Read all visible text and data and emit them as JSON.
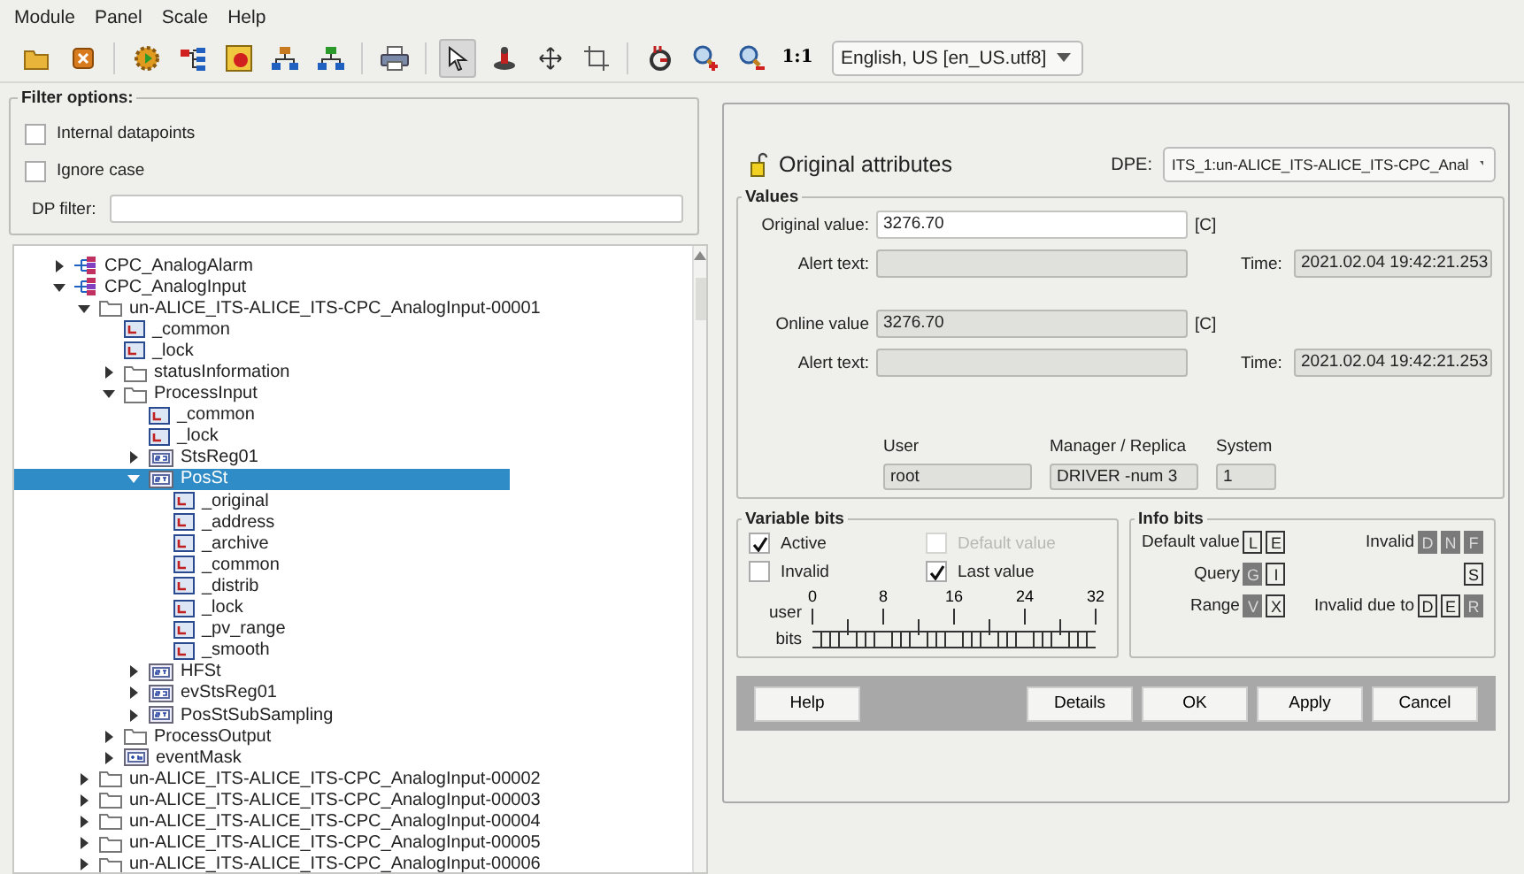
{
  "menu": [
    "Module",
    "Panel",
    "Scale",
    "Help"
  ],
  "toolbar": {
    "tools": [
      {
        "kind": "open",
        "selected": false
      },
      {
        "kind": "close",
        "selected": false
      },
      {
        "kind": "sep"
      },
      {
        "kind": "gear",
        "selected": false
      },
      {
        "kind": "nodes",
        "selected": false
      },
      {
        "kind": "panel",
        "selected": false
      },
      {
        "kind": "tree",
        "selected": false
      },
      {
        "kind": "tree2",
        "selected": false
      },
      {
        "kind": "sep"
      },
      {
        "kind": "print",
        "selected": false
      },
      {
        "kind": "sep"
      },
      {
        "kind": "pointer",
        "selected": true
      },
      {
        "kind": "stamp",
        "selected": false
      },
      {
        "kind": "move",
        "selected": false
      },
      {
        "kind": "frame",
        "selected": false
      },
      {
        "kind": "sep"
      },
      {
        "kind": "g",
        "selected": false
      },
      {
        "kind": "zoomin",
        "selected": false
      },
      {
        "kind": "zoomout",
        "selected": false
      },
      {
        "kind": "text",
        "label": "1:1",
        "selected": false
      }
    ],
    "language": "English, US [en_US.utf8]"
  },
  "filter": {
    "title": "Filter options:",
    "checkboxes": [
      {
        "label": "Internal datapoints",
        "checked": false
      },
      {
        "label": "Ignore case",
        "checked": false
      }
    ],
    "dp_filter": {
      "label": "DP filter:"
    }
  },
  "tree": {
    "items": [
      {
        "label": "CPC_AnalogAlarm",
        "kind": "dpt",
        "expanded": false,
        "selected": false
      },
      {
        "label": "CPC_AnalogInput",
        "kind": "dpt",
        "expanded": true,
        "selected": false,
        "children": [
          {
            "label": "un-ALICE_ITS-ALICE_ITS-CPC_AnalogInput-00001",
            "kind": "folder",
            "expanded": true,
            "selected": false,
            "children": [
              {
                "label": "_common",
                "kind": "config",
                "selected": false
              },
              {
                "label": "_lock",
                "kind": "config",
                "selected": false
              },
              {
                "label": "statusInformation",
                "kind": "folder",
                "expanded": false,
                "selected": false
              },
              {
                "label": "ProcessInput",
                "kind": "folder",
                "expanded": true,
                "selected": false,
                "children": [
                  {
                    "label": "_common",
                    "kind": "config",
                    "selected": false
                  },
                  {
                    "label": "_lock",
                    "kind": "config",
                    "selected": false
                  },
                  {
                    "label": "StsReg01",
                    "kind": "int",
                    "expanded": false,
                    "selected": false
                  },
                  {
                    "label": "PosSt",
                    "kind": "float",
                    "expanded": true,
                    "selected": true,
                    "children": [
                      {
                        "label": "_original",
                        "kind": "config",
                        "selected": false
                      },
                      {
                        "label": "_address",
                        "kind": "config",
                        "selected": false
                      },
                      {
                        "label": "_archive",
                        "kind": "config",
                        "selected": false
                      },
                      {
                        "label": "_common",
                        "kind": "config",
                        "selected": false
                      },
                      {
                        "label": "_distrib",
                        "kind": "config",
                        "selected": false
                      },
                      {
                        "label": "_lock",
                        "kind": "config",
                        "selected": false
                      },
                      {
                        "label": "_pv_range",
                        "kind": "config",
                        "selected": false
                      },
                      {
                        "label": "_smooth",
                        "kind": "config",
                        "selected": false
                      }
                    ]
                  },
                  {
                    "label": "HFSt",
                    "kind": "float",
                    "expanded": false,
                    "selected": false
                  },
                  {
                    "label": "evStsReg01",
                    "kind": "int",
                    "expanded": false,
                    "selected": false
                  },
                  {
                    "label": "PosStSubSampling",
                    "kind": "float",
                    "expanded": false,
                    "selected": false
                  }
                ]
              },
              {
                "label": "ProcessOutput",
                "kind": "folder",
                "expanded": false,
                "selected": false
              },
              {
                "label": "eventMask",
                "kind": "bits",
                "expanded": false,
                "selected": false
              }
            ]
          },
          {
            "label": "un-ALICE_ITS-ALICE_ITS-CPC_AnalogInput-00002",
            "kind": "folder",
            "expanded": false,
            "selected": false
          },
          {
            "label": "un-ALICE_ITS-ALICE_ITS-CPC_AnalogInput-00003",
            "kind": "folder",
            "expanded": false,
            "selected": false
          },
          {
            "label": "un-ALICE_ITS-ALICE_ITS-CPC_AnalogInput-00004",
            "kind": "folder",
            "expanded": false,
            "selected": false
          },
          {
            "label": "un-ALICE_ITS-ALICE_ITS-CPC_AnalogInput-00005",
            "kind": "folder",
            "expanded": false,
            "selected": false
          },
          {
            "label": "un-ALICE_ITS-ALICE_ITS-CPC_AnalogInput-00006",
            "kind": "folder",
            "expanded": false,
            "selected": false
          }
        ]
      }
    ]
  },
  "panel": {
    "title": "Original attributes",
    "dpe": {
      "label": "DPE:",
      "value": "ITS_1:un-ALICE_ITS-ALICE_ITS-CPC_Anal"
    },
    "values": {
      "title": "Values",
      "blocks": [
        {
          "value_label": "Original value:",
          "value": "3276.70",
          "readonly": false,
          "unit": "[C]",
          "alert_label": "Alert text:",
          "time_label": "Time:",
          "time": "2021.02.04 19:42:21.253"
        },
        {
          "value_label": "Online value",
          "value": "3276.70",
          "readonly": true,
          "unit": "[C]",
          "alert_label": "Alert text:",
          "time_label": "Time:",
          "time": "2021.02.04 19:42:21.253"
        }
      ],
      "source": [
        {
          "label": "User",
          "value": "root"
        },
        {
          "label": "Manager / Replica",
          "value": "DRIVER -num 3"
        },
        {
          "label": "System",
          "value": "1"
        }
      ]
    },
    "variable_bits": {
      "title": "Variable bits",
      "checkboxes": [
        {
          "label": "Active",
          "checked": true,
          "disabled": false
        },
        {
          "label": "Default value",
          "checked": false,
          "disabled": true
        },
        {
          "label": "Invalid",
          "checked": false,
          "disabled": false
        },
        {
          "label": "Last value",
          "checked": true,
          "disabled": false
        }
      ],
      "user_bits": {
        "label_1": "user",
        "label_2": "bits",
        "ticks": [
          "0",
          "8",
          "16",
          "24",
          "32"
        ]
      }
    },
    "info_bits": {
      "title": "Info bits",
      "groups": [
        {
          "label": "Default value",
          "bits": [
            {
              "letter": "L",
              "on": false
            },
            {
              "letter": "E",
              "on": false
            }
          ]
        },
        {
          "label": "Invalid",
          "bits": [
            {
              "letter": "D",
              "on": true
            },
            {
              "letter": "N",
              "on": true
            },
            {
              "letter": "F",
              "on": true
            }
          ]
        },
        {
          "label": "Query",
          "bits": [
            {
              "letter": "G",
              "on": true
            },
            {
              "letter": "I",
              "on": false
            }
          ]
        },
        {
          "bits": [
            {
              "letter": "S",
              "on": false
            }
          ]
        },
        {
          "label": "Range",
          "bits": [
            {
              "letter": "V",
              "on": true
            },
            {
              "letter": "X",
              "on": false
            }
          ]
        },
        {
          "label": "Invalid due to",
          "bits": [
            {
              "letter": "D",
              "on": false
            },
            {
              "letter": "E",
              "on": false
            },
            {
              "letter": "R",
              "on": true
            }
          ]
        }
      ]
    },
    "buttons": [
      "Help",
      "Details",
      "OK",
      "Apply",
      "Cancel"
    ]
  }
}
